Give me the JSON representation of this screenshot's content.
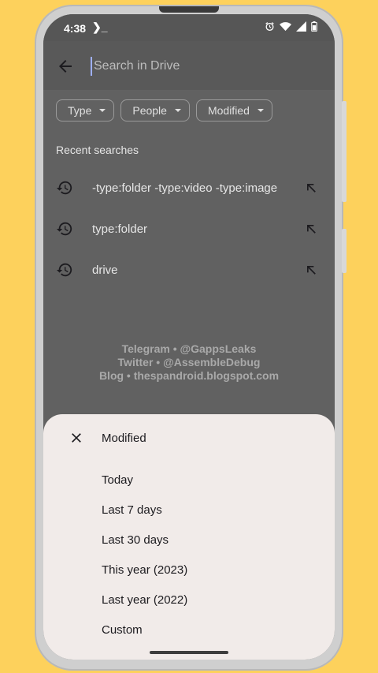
{
  "status": {
    "time": "4:38",
    "terminal": "❯_"
  },
  "search": {
    "placeholder": "Search in Drive"
  },
  "chips": [
    {
      "label": "Type"
    },
    {
      "label": "People"
    },
    {
      "label": "Modified"
    }
  ],
  "recent": {
    "title": "Recent searches",
    "items": [
      {
        "text": "-type:folder -type:video -type:image"
      },
      {
        "text": "type:folder"
      },
      {
        "text": "drive"
      }
    ]
  },
  "watermark": {
    "line1": "Telegram • @GappsLeaks",
    "line2": "Twitter • @AssembleDebug",
    "line3": "Blog • thespandroid.blogspot.com"
  },
  "sheet": {
    "title": "Modified",
    "options": [
      {
        "label": "Today"
      },
      {
        "label": "Last 7 days"
      },
      {
        "label": "Last 30 days"
      },
      {
        "label": "This year (2023)"
      },
      {
        "label": "Last year (2022)"
      },
      {
        "label": "Custom"
      }
    ]
  },
  "colors": {
    "background": "#fdd15c",
    "scrim": "#616161",
    "sheet": "#f1ebe9"
  }
}
